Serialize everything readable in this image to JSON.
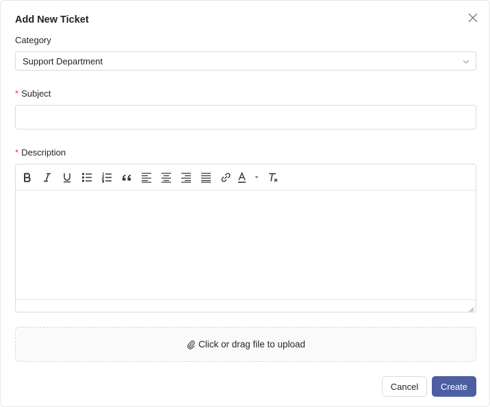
{
  "dialog": {
    "title": "Add New Ticket"
  },
  "form": {
    "category": {
      "label": "Category",
      "selected": "Support Department"
    },
    "subject": {
      "required_mark": "*",
      "label": "Subject",
      "value": "",
      "placeholder": ""
    },
    "description": {
      "required_mark": "*",
      "label": "Description",
      "value": ""
    },
    "upload": {
      "label": "Click or drag file to upload"
    }
  },
  "toolbar": {
    "items": [
      "bold-icon",
      "italic-icon",
      "underline-icon",
      "bullet-list-icon",
      "numbered-list-icon",
      "blockquote-icon",
      "align-left-icon",
      "align-center-icon",
      "align-right-icon",
      "align-justify-icon",
      "link-icon",
      "text-color-icon",
      "clear-format-icon"
    ]
  },
  "actions": {
    "cancel_label": "Cancel",
    "create_label": "Create"
  },
  "colors": {
    "primary": "#4d5ea3",
    "required": "#e0383e",
    "border": "#d9d9d9"
  }
}
